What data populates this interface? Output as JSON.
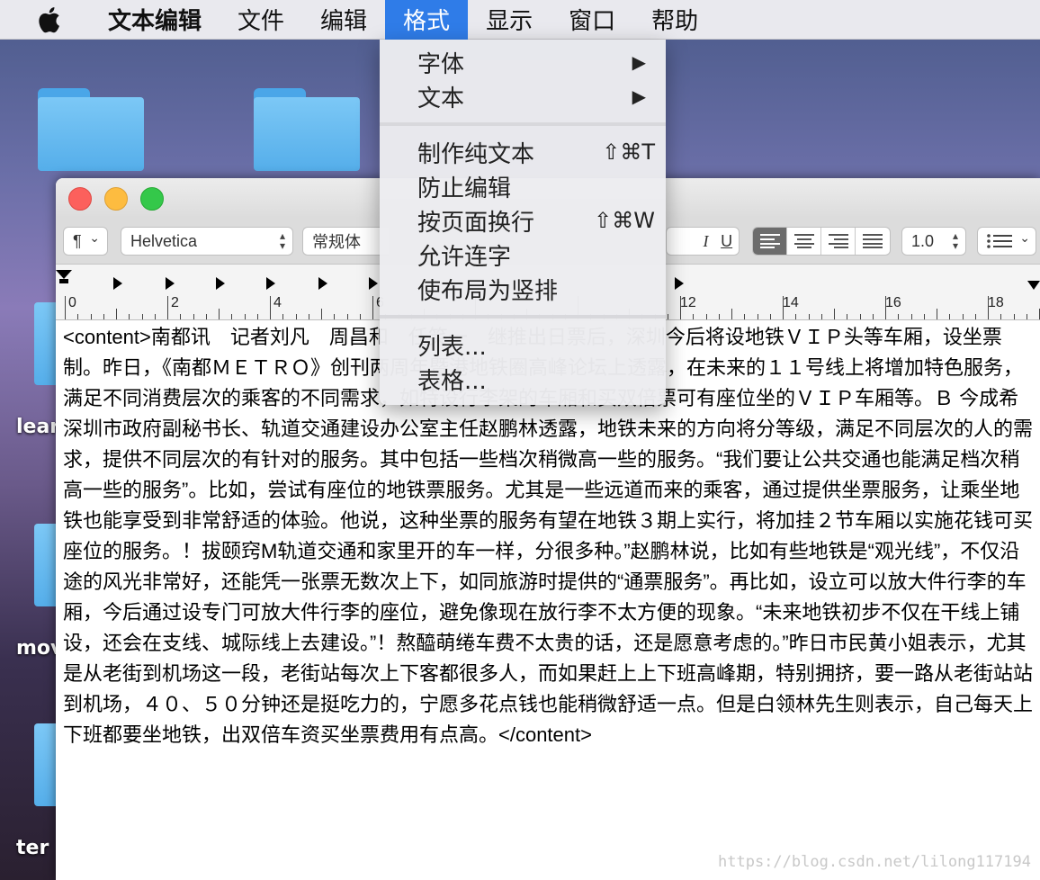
{
  "menubar": {
    "app_name": "文本编辑",
    "items": [
      "文件",
      "编辑",
      "格式",
      "显示",
      "窗口",
      "帮助"
    ],
    "active_item": "格式"
  },
  "desktop": {
    "labels": [
      "lear",
      "mov",
      "ter"
    ]
  },
  "toolbar": {
    "paragraph_label": "¶",
    "font_family": "Helvetica",
    "font_style": "常规体",
    "italic_label": "I",
    "underline_label": "U",
    "line_spacing": "1.0"
  },
  "ruler": {
    "labels": [
      "0",
      "2",
      "4",
      "6",
      "12",
      "14",
      "16",
      "18"
    ]
  },
  "format_menu": {
    "items": [
      {
        "label": "字体",
        "submenu": "▶"
      },
      {
        "label": "文本",
        "submenu": "▶"
      },
      {
        "label": "制作纯文本",
        "shortcut": "⇧⌘T"
      },
      {
        "label": "防止编辑"
      },
      {
        "label": "按页面换行",
        "shortcut": "⇧⌘W"
      },
      {
        "label": "允许连字"
      },
      {
        "label": "使布局为竖排"
      },
      {
        "label": "列表..."
      },
      {
        "label": "表格..."
      }
    ]
  },
  "document": {
    "text": "<content>南都讯　记者刘凡　周昌和　任笑一　继推出日票后，深圳今后将设地铁ＶＩＰ头等车厢，设坐票制。昨日，《南都ＭＥＴＲＯ》创刊两周年暨港地铁圈高峰论坛上透露，在未来的１１号线上将增加特色服务，满足不同消费层次的乘客的不同需求，如特设行李架的车厢和买双倍票可有座位坐的ＶＩＰ车厢等。Ｂ 今成希深圳市政府副秘书长、轨道交通建设办公室主任赵鹏林透露，地铁未来的方向将分等级，满足不同层次的人的需求，提供不同层次的有针对的服务。其中包括一些档次稍微高一些的服务。“我们要让公共交通也能满足档次稍高一些的服务”。比如，尝试有座位的地铁票服务。尤其是一些远道而来的乘客，通过提供坐票服务，让乘坐地铁也能享受到非常舒适的体验。他说，这种坐票的服务有望在地铁３期上实行，将加挂２节车厢以实施花钱可买座位的服务。！拔颐窍M轨道交通和家里开的车一样，分很多种。”赵鹏林说，比如有些地铁是“观光线”，不仅沿途的风光非常好，还能凭一张票无数次上下，如同旅游时提供的“通票服务”。再比如，设立可以放大件行李的车厢，今后通过设专门可放大件行李的座位，避免像现在放行李不太方便的现象。“未来地铁初步不仅在干线上铺设，还会在支线、城际线上去建设。”！熬醯萌绻车费不太贵的话，还是愿意考虑的。”昨日市民黄小姐表示，尤其是从老街到机场这一段，老街站每次上下客都很多人，而如果赶上上下班高峰期，特别拥挤，要一路从老街站站到机场，４０、５０分钟还是挺吃力的，宁愿多花点钱也能稍微舒适一点。但是白领林先生则表示，自己每天上下班都要坐地铁，出双倍车资买坐票费用有点高。</content>"
  },
  "watermark": "https://blog.csdn.net/lilong117194",
  "colors": {
    "menu_highlight": "#2f7ce8",
    "close": "#fc605c",
    "minimize": "#fdbc40",
    "zoom": "#34c84a"
  }
}
